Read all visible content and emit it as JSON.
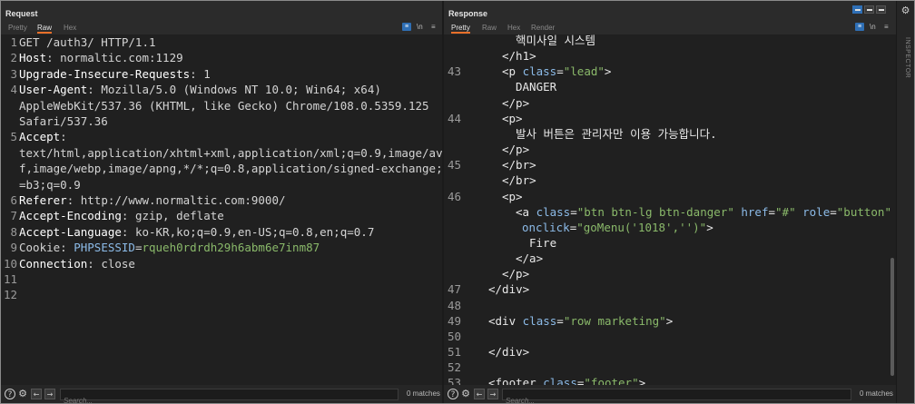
{
  "request": {
    "title": "Request",
    "tabs": [
      "Pretty",
      "Raw",
      "Hex"
    ],
    "active_tab": "Raw",
    "toolbar": {
      "wrap_icon": "wrap-icon",
      "newline_label": "\\n",
      "menu_icon": "menu-icon"
    },
    "lines": [
      {
        "n": "1",
        "t": "GET /auth3/ HTTP/1.1"
      },
      {
        "n": "2",
        "t": "Host: normaltic.com:1129"
      },
      {
        "n": "3",
        "t": "Upgrade-Insecure-Requests: 1"
      },
      {
        "n": "4",
        "t": "User-Agent: Mozilla/5.0 (Windows NT 10.0; Win64; x64)"
      },
      {
        "n": "",
        "t": "AppleWebKit/537.36 (KHTML, like Gecko) Chrome/108.0.5359.125"
      },
      {
        "n": "",
        "t": "Safari/537.36"
      },
      {
        "n": "5",
        "t": "Accept:"
      },
      {
        "n": "",
        "t": "text/html,application/xhtml+xml,application/xml;q=0.9,image/avi"
      },
      {
        "n": "",
        "t": "f,image/webp,image/apng,*/*;q=0.8,application/signed-exchange;v"
      },
      {
        "n": "",
        "t": "=b3;q=0.9"
      },
      {
        "n": "6",
        "t": "Referer: http://www.normaltic.com:9000/"
      },
      {
        "n": "7",
        "t": "Accept-Encoding: gzip, deflate"
      },
      {
        "n": "8",
        "t": "Accept-Language: ko-KR,ko;q=0.9,en-US;q=0.8,en;q=0.7"
      },
      {
        "n": "9",
        "t": "Cookie: PHPSESSID=rqueh0rdrdh29h6abm6e7inm87",
        "cookie_name": "PHPSESSID",
        "cookie_value": "rqueh0rdrdh29h6abm6e7inm87"
      },
      {
        "n": "10",
        "t": "Connection: close"
      },
      {
        "n": "11",
        "t": ""
      },
      {
        "n": "12",
        "t": ""
      }
    ],
    "search_placeholder": "Search...",
    "matches": "0 matches"
  },
  "response": {
    "title": "Response",
    "tabs": [
      "Pretty",
      "Raw",
      "Hex",
      "Render"
    ],
    "active_tab": "Pretty",
    "toolbar": {
      "wrap_icon": "wrap-icon",
      "newline_label": "\\n",
      "menu_icon": "menu-icon"
    },
    "lines": [
      {
        "n": "",
        "indent": 3,
        "parts": [
          [
            "x",
            "핵미사일 시스템"
          ]
        ]
      },
      {
        "n": "",
        "indent": 2,
        "parts": [
          [
            "t",
            "</h1>"
          ]
        ]
      },
      {
        "n": "43",
        "indent": 2,
        "parts": [
          [
            "t",
            "<p "
          ],
          [
            "a",
            "class"
          ],
          [
            "x",
            "="
          ],
          [
            "v",
            "\"lead\""
          ],
          [
            "t",
            ">"
          ]
        ]
      },
      {
        "n": "",
        "indent": 3,
        "parts": [
          [
            "x",
            "DANGER"
          ]
        ]
      },
      {
        "n": "",
        "indent": 2,
        "parts": [
          [
            "t",
            "</p>"
          ]
        ]
      },
      {
        "n": "44",
        "indent": 2,
        "parts": [
          [
            "t",
            "<p>"
          ]
        ]
      },
      {
        "n": "",
        "indent": 3,
        "parts": [
          [
            "x",
            "발사 버튼은 관리자만 이용 가능합니다."
          ]
        ]
      },
      {
        "n": "",
        "indent": 2,
        "parts": [
          [
            "t",
            "</p>"
          ]
        ]
      },
      {
        "n": "45",
        "indent": 2,
        "parts": [
          [
            "t",
            "</br>"
          ]
        ]
      },
      {
        "n": "",
        "indent": 2,
        "parts": [
          [
            "t",
            "</br>"
          ]
        ]
      },
      {
        "n": "46",
        "indent": 2,
        "parts": [
          [
            "t",
            "<p>"
          ]
        ]
      },
      {
        "n": "",
        "indent": 3,
        "parts": [
          [
            "t",
            "<a "
          ],
          [
            "a",
            "class"
          ],
          [
            "x",
            "="
          ],
          [
            "v",
            "\"btn btn-lg btn-danger\""
          ],
          [
            "x",
            " "
          ],
          [
            "a",
            "href"
          ],
          [
            "x",
            "="
          ],
          [
            "v",
            "\"#\""
          ],
          [
            "x",
            " "
          ],
          [
            "a",
            "role"
          ],
          [
            "x",
            "="
          ],
          [
            "v",
            "\"button\""
          ]
        ]
      },
      {
        "n": "",
        "indent": 3,
        "extra": 1,
        "parts": [
          [
            "a",
            "onclick"
          ],
          [
            "x",
            "="
          ],
          [
            "v",
            "\"goMenu('1018','')\""
          ],
          [
            "t",
            ">"
          ]
        ]
      },
      {
        "n": "",
        "indent": 4,
        "parts": [
          [
            "x",
            "Fire"
          ]
        ]
      },
      {
        "n": "",
        "indent": 3,
        "parts": [
          [
            "t",
            "</a>"
          ]
        ]
      },
      {
        "n": "",
        "indent": 2,
        "parts": [
          [
            "t",
            "</p>"
          ]
        ]
      },
      {
        "n": "47",
        "indent": 1,
        "parts": [
          [
            "t",
            "</div>"
          ]
        ]
      },
      {
        "n": "48",
        "indent": 0,
        "parts": []
      },
      {
        "n": "49",
        "indent": 1,
        "parts": [
          [
            "t",
            "<div "
          ],
          [
            "a",
            "class"
          ],
          [
            "x",
            "="
          ],
          [
            "v",
            "\"row marketing\""
          ],
          [
            "t",
            ">"
          ]
        ]
      },
      {
        "n": "50",
        "indent": 0,
        "parts": []
      },
      {
        "n": "51",
        "indent": 1,
        "parts": [
          [
            "t",
            "</div>"
          ]
        ]
      },
      {
        "n": "52",
        "indent": 0,
        "parts": []
      },
      {
        "n": "53",
        "indent": 1,
        "parts": [
          [
            "t",
            "<footer "
          ],
          [
            "a",
            "class"
          ],
          [
            "x",
            "="
          ],
          [
            "v",
            "\"footer\""
          ],
          [
            "t",
            ">"
          ]
        ]
      }
    ],
    "search_placeholder": "Search...",
    "matches": "0 matches"
  },
  "inspector": {
    "label": "INSPECTOR",
    "icon": "gear-icon"
  },
  "colors": {
    "accent": "#e8702a",
    "keyword": "#ffffff",
    "attr": "#8cbbe8",
    "value": "#8ab96a"
  }
}
